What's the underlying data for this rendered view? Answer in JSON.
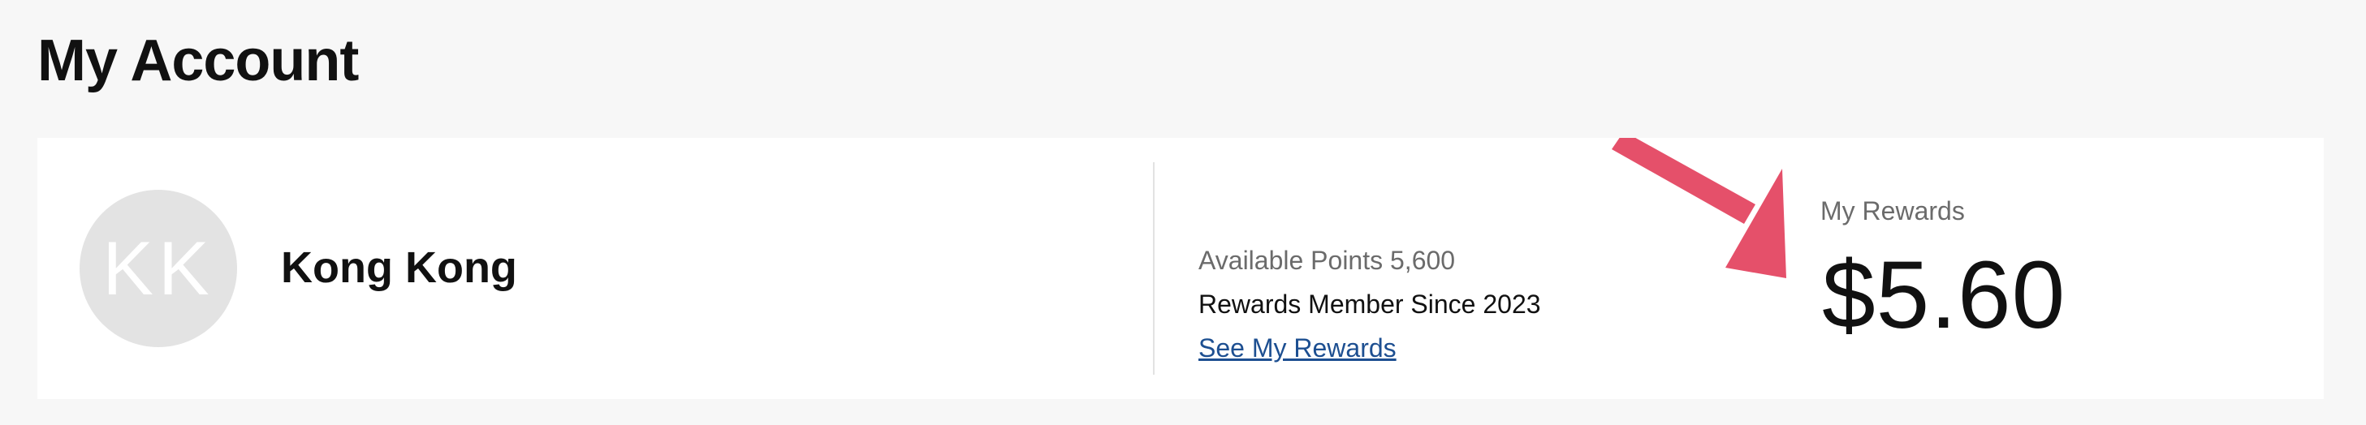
{
  "page": {
    "title": "My Account"
  },
  "profile": {
    "initials": "KK",
    "name": "Kong Kong"
  },
  "points": {
    "available_text": "Available Points 5,600",
    "member_since_text": "Rewards Member Since 2023",
    "link_label": "See My Rewards"
  },
  "rewards": {
    "label": "My Rewards",
    "value": "$5.60"
  },
  "annotation": {
    "arrow_color": "#e5506a"
  }
}
